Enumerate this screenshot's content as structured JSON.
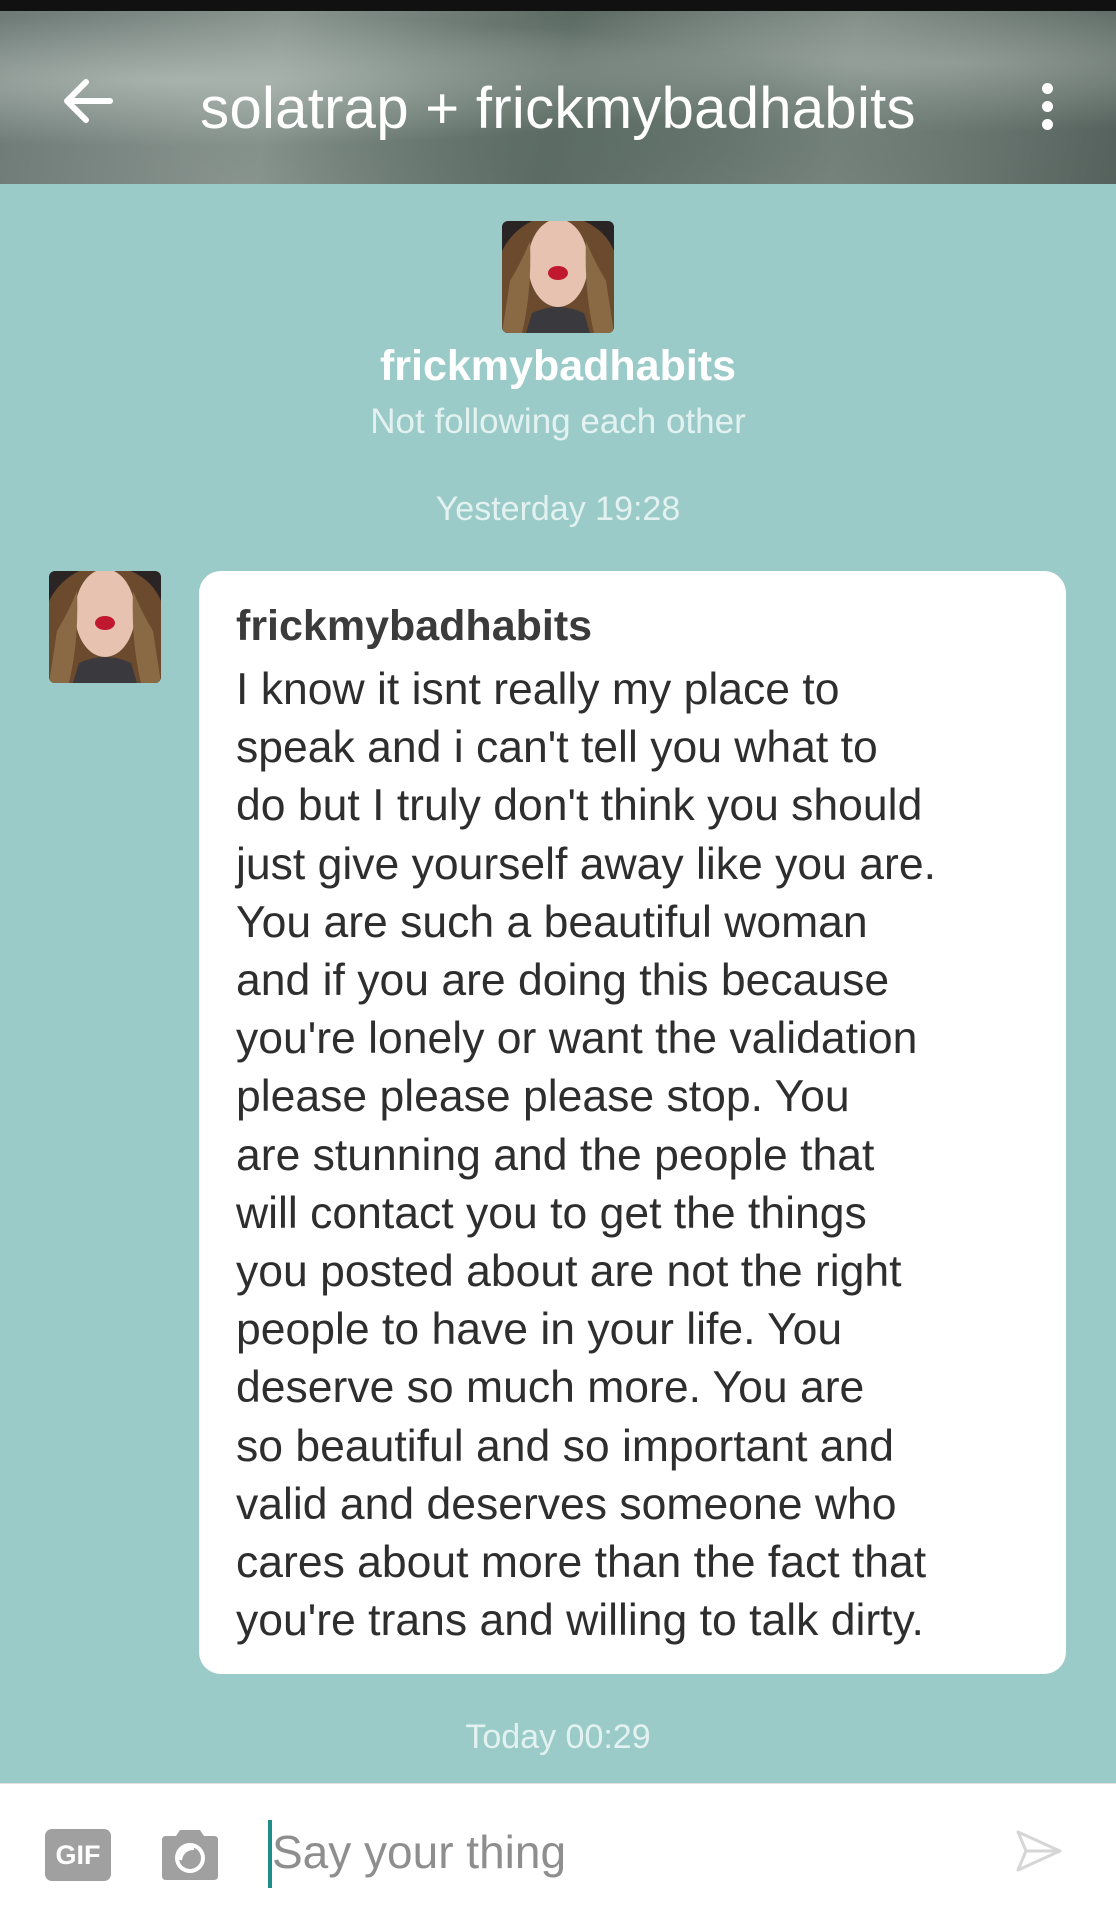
{
  "header": {
    "title": "solatrap + frickmybadhabits",
    "back_icon": "arrow-left-icon",
    "menu_icon": "more-vertical-icon"
  },
  "profile": {
    "name": "frickmybadhabits",
    "status": "Not following each other"
  },
  "timestamps": {
    "first": "Yesterday 19:28",
    "second": "Today 00:29"
  },
  "message": {
    "sender": "frickmybadhabits",
    "lines": [
      "I know it isnt really my place to",
      "speak and i can't tell you what to",
      "do but I truly don't think you should",
      "just give yourself away like you are.",
      "You are such a beautiful woman",
      "and if you are doing this because",
      "you're lonely or want the validation",
      "please please please stop. You",
      "are stunning and the people that",
      "will contact you to get the things",
      "you posted about are not the right",
      "people to have in your life. You",
      "deserve so much more. You are",
      "so beautiful and so important and",
      "valid and deserves someone who",
      "cares about more than the fact that",
      "you're trans and willing to talk dirty."
    ]
  },
  "composer": {
    "gif_label": "GIF",
    "placeholder": "Say your thing",
    "camera_icon": "camera-icon",
    "send_icon": "send-icon"
  },
  "colors": {
    "background": "#9acbc8",
    "bubble": "#ffffff",
    "cursor": "#1d8f88"
  }
}
